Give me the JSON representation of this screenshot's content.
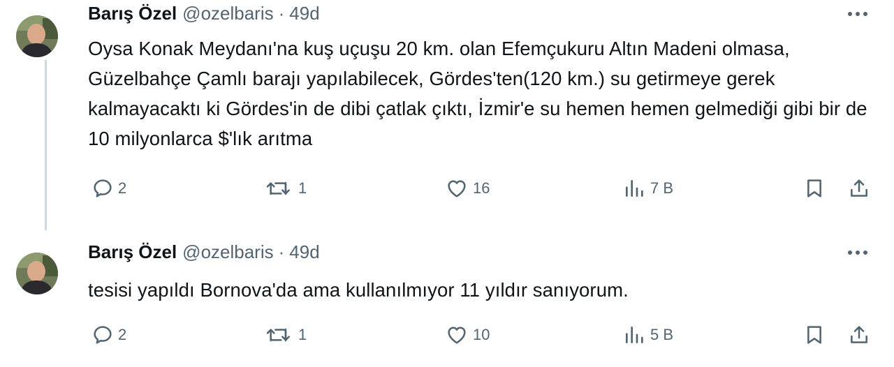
{
  "tweets": [
    {
      "name": "Barış Özel",
      "handle": "@ozelbaris",
      "separator": "·",
      "time": "49d",
      "text": "Oysa Konak Meydanı'na kuş uçuşu 20 km. olan Efemçukuru Altın Madeni olmasa, Güzelbahçe Çamlı barajı yapılabilecek, Gördes'ten(120 km.) su getirmeye gerek kalmayacaktı ki Gördes'in de dibi çatlak çıktı, İzmir'e su hemen hemen gelmediği gibi bir de 10 milyonlarca $'lık arıtma",
      "replies": "2",
      "reposts": "1",
      "likes": "16",
      "views": "7 B"
    },
    {
      "name": "Barış Özel",
      "handle": "@ozelbaris",
      "separator": "·",
      "time": "49d",
      "text": "tesisi yapıldı Bornova'da ama kullanılmıyor 11 yıldır sanıyorum.",
      "replies": "2",
      "reposts": "1",
      "likes": "10",
      "views": "5 B"
    }
  ],
  "icons": {
    "reply": "reply-icon",
    "repost": "repost-icon",
    "like": "heart-icon",
    "views": "views-icon",
    "bookmark": "bookmark-icon",
    "share": "share-icon",
    "more": "more-icon"
  },
  "colors": {
    "text": "#0f1419",
    "secondary": "#536471",
    "thread_line": "#cfd9de",
    "background": "#ffffff"
  }
}
